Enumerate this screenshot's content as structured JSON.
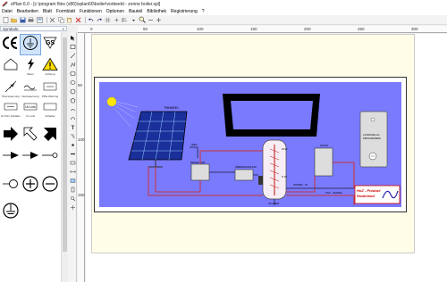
{
  "window": {
    "title": "sPlan 6.0 - [c:\\program files (x86)\\splan60\\boiler\\vorbeeld - zonne boiler.spl]"
  },
  "menu": [
    "Datei",
    "Bearbeiten",
    "Blatt",
    "Formblatt",
    "Funktionen",
    "Optionen",
    "Bauteil",
    "Bibliothek",
    "Registrierung",
    "?"
  ],
  "panel": {
    "title": "Symbole",
    "close": "×"
  },
  "symbols": [
    {
      "label": ""
    },
    {
      "label": ""
    },
    {
      "label": ""
    },
    {
      "label": ""
    },
    {
      "label": "Motor"
    },
    {
      "label": "Achtung"
    },
    {
      "label": "Überspannung"
    },
    {
      "label": "Netzspannung"
    },
    {
      "label": "PPE-Warning"
    },
    {
      "label": "R-Ohm Schalter"
    },
    {
      "label": "Un Link"
    },
    {
      "label": "Schalter"
    }
  ],
  "ruler": {
    "h": [
      "0",
      "50",
      "100",
      "150",
      "200",
      "250",
      "300"
    ],
    "v": [
      "50",
      "100",
      "150"
    ]
  },
  "diagram": {
    "panel_label": "PANNEEL",
    "regelaar_label": "REGELAAR",
    "oberwachung_label": "ÜBERWACHUNG",
    "ketel_label": "KETEL",
    "sturing_label": "LOGIKKELLA\nPROGRAMMA",
    "warm_label": "W.W.",
    "koud_label": "K.W.",
    "water_in_label": "WATER - IN",
    "tap_water_label": "TAP - WATER",
    "afvoer_label": "AFVOER",
    "logo_line1": "HoZ - Product",
    "logo_line2": "Roderland"
  },
  "colors": {
    "diagram_bg": "#7a7aff",
    "sheet_bg": "#fffce8",
    "selected": "#cfe3fb"
  }
}
